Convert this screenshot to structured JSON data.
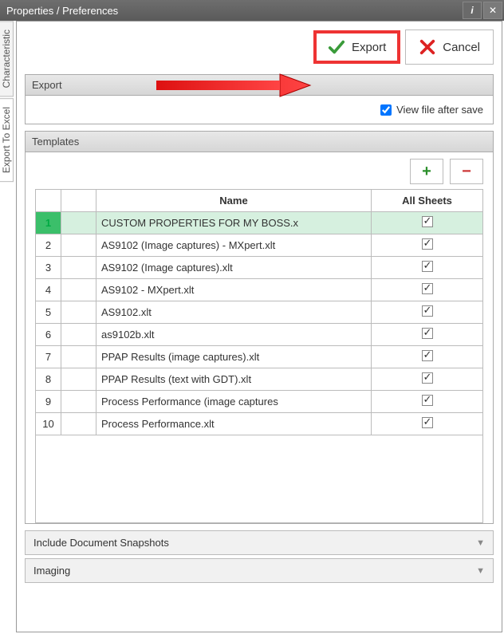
{
  "title": "Properties / Preferences",
  "sidetabs": {
    "characteristic": "Characteristic",
    "export_excel": "Export To Excel"
  },
  "buttons": {
    "export": "Export",
    "cancel": "Cancel"
  },
  "export_panel": {
    "header": "Export",
    "view_after_save": "View file after save",
    "view_checked": true
  },
  "templates_panel": {
    "header": "Templates",
    "columns": {
      "name": "Name",
      "all_sheets": "All Sheets"
    },
    "rows": [
      {
        "n": "1",
        "name": "CUSTOM PROPERTIES FOR MY BOSS.x",
        "checked": true,
        "selected": true
      },
      {
        "n": "2",
        "name": "AS9102 (Image captures) - MXpert.xlt",
        "checked": true,
        "selected": false
      },
      {
        "n": "3",
        "name": "AS9102 (Image captures).xlt",
        "checked": true,
        "selected": false
      },
      {
        "n": "4",
        "name": "AS9102 - MXpert.xlt",
        "checked": true,
        "selected": false
      },
      {
        "n": "5",
        "name": "AS9102.xlt",
        "checked": true,
        "selected": false
      },
      {
        "n": "6",
        "name": "as9102b.xlt",
        "checked": true,
        "selected": false
      },
      {
        "n": "7",
        "name": "PPAP Results (image captures).xlt",
        "checked": true,
        "selected": false
      },
      {
        "n": "8",
        "name": "PPAP Results (text with GDT).xlt",
        "checked": true,
        "selected": false
      },
      {
        "n": "9",
        "name": "Process Performance (image captures",
        "checked": true,
        "selected": false
      },
      {
        "n": "10",
        "name": "Process Performance.xlt",
        "checked": true,
        "selected": false
      }
    ]
  },
  "collapsibles": {
    "snapshots": "Include Document Snapshots",
    "imaging": "Imaging"
  },
  "icons": {
    "add": "+",
    "remove": "−",
    "info": "i",
    "close": "✕",
    "chevron": "▼"
  }
}
